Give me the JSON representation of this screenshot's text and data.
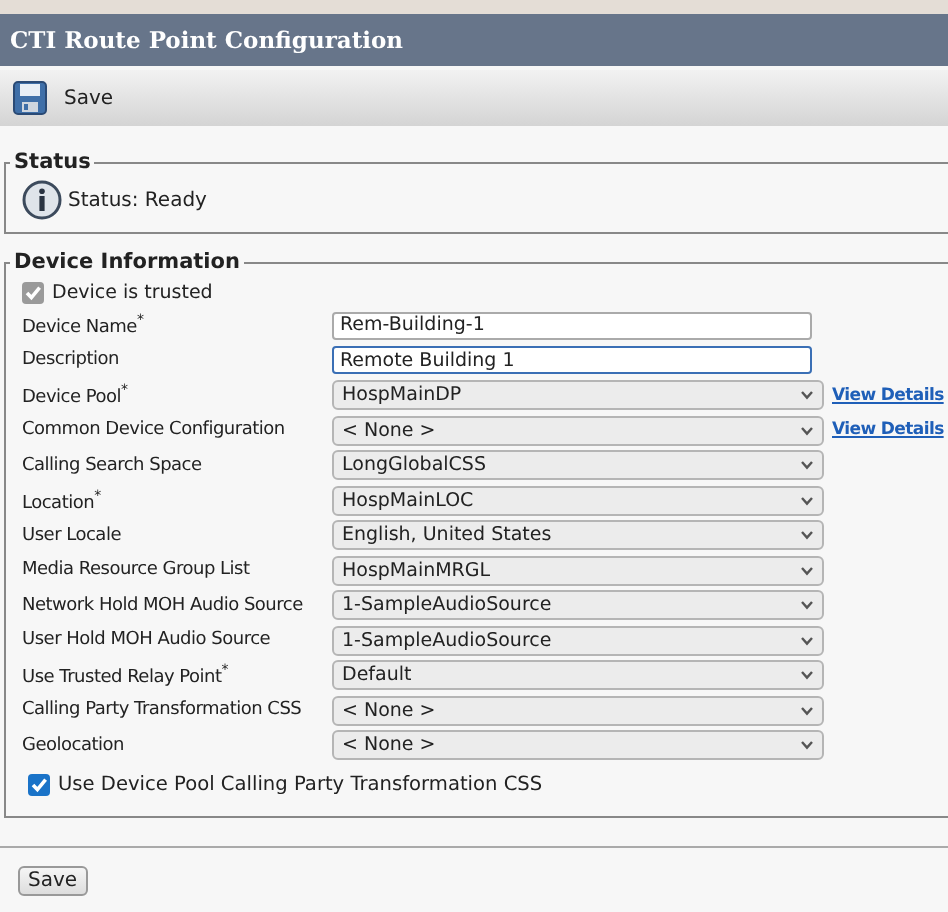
{
  "window": {
    "title": "CTI Route Point Configuration"
  },
  "toolbar": {
    "save_label": "Save"
  },
  "status": {
    "legend": "Status",
    "message": "Status: Ready"
  },
  "device_information": {
    "legend": "Device Information",
    "trusted": {
      "label": "Device is trusted",
      "checked": true,
      "disabled": true
    },
    "fields": [
      {
        "label": "Device Name$^{*}$",
        "kind": "text",
        "value": "Rem-Building-1",
        "focused": false
      },
      {
        "label": "Description",
        "kind": "text",
        "value": "Remote Building 1",
        "focused": true
      },
      {
        "label": "Device Pool$^{*}$",
        "kind": "select",
        "value": "HospMainDP",
        "link": "View Details"
      },
      {
        "label": "Common Device Configuration",
        "kind": "select",
        "value": "< None >",
        "link": "View Details"
      },
      {
        "label": "Calling Search Space",
        "kind": "select",
        "value": "LongGlobalCSS"
      },
      {
        "label": "Location$^{*}$",
        "kind": "select",
        "value": "HospMainLOC"
      },
      {
        "label": "User Locale",
        "kind": "select",
        "value": "English, United States"
      },
      {
        "label": "Media Resource Group List",
        "kind": "select",
        "value": "HospMainMRGL"
      },
      {
        "label": "Network Hold MOH Audio Source",
        "kind": "select",
        "value": "1-SampleAudioSource"
      },
      {
        "label": "User Hold MOH Audio Source",
        "kind": "select",
        "value": "1-SampleAudioSource"
      },
      {
        "label": "Use Trusted Relay Point$^{*}$",
        "kind": "select",
        "value": "Default"
      },
      {
        "label": "Calling Party Transformation CSS",
        "kind": "select",
        "value": "< None >"
      },
      {
        "label": "Geolocation",
        "kind": "select",
        "value": "< None >"
      }
    ],
    "use_pool_css": {
      "label": "Use Device Pool Calling Party Transformation CSS",
      "checked": true,
      "disabled": false
    }
  },
  "footer": {
    "save_label": "Save"
  }
}
